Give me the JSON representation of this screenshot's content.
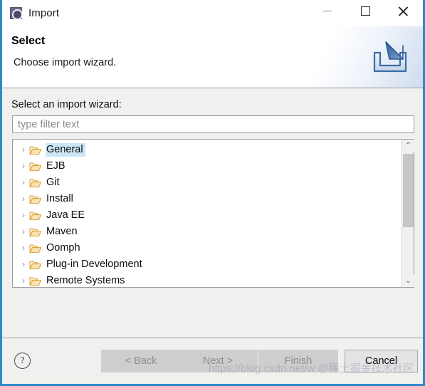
{
  "window": {
    "title": "Import",
    "icon": "eclipse-import-icon",
    "controls": {
      "minimize": "–",
      "maximize": "□",
      "close": "✕"
    }
  },
  "banner": {
    "title": "Select",
    "description": "Choose import wizard.",
    "icon": "import-tray-arrow-icon"
  },
  "main": {
    "wizard_label": "Select an import wizard:",
    "filter": {
      "value": "",
      "placeholder": "type filter text"
    },
    "tree": {
      "expand_arrow": "›",
      "items": [
        {
          "label": "General",
          "selected": true
        },
        {
          "label": "EJB",
          "selected": false
        },
        {
          "label": "Git",
          "selected": false
        },
        {
          "label": "Install",
          "selected": false
        },
        {
          "label": "Java EE",
          "selected": false
        },
        {
          "label": "Maven",
          "selected": false
        },
        {
          "label": "Oomph",
          "selected": false
        },
        {
          "label": "Plug-in Development",
          "selected": false
        },
        {
          "label": "Remote Systems",
          "selected": false
        }
      ],
      "scrollbar": {
        "up_arrow": "⌃",
        "down_arrow": "⌄"
      }
    }
  },
  "footer": {
    "help_label": "?",
    "buttons": [
      {
        "label": "< Back",
        "enabled": false
      },
      {
        "label": "Next >",
        "enabled": false
      },
      {
        "label": "Finish",
        "enabled": false
      },
      {
        "label": "Cancel",
        "enabled": true
      }
    ]
  },
  "watermark": {
    "text": "https://blog.csdn.net/w  @稀土掘金技术社区"
  },
  "colors": {
    "window_border": "#2d8ac7",
    "selection": "#cde6f7",
    "folder": "#e8b86d",
    "banner_accent": "#cfdcee"
  }
}
